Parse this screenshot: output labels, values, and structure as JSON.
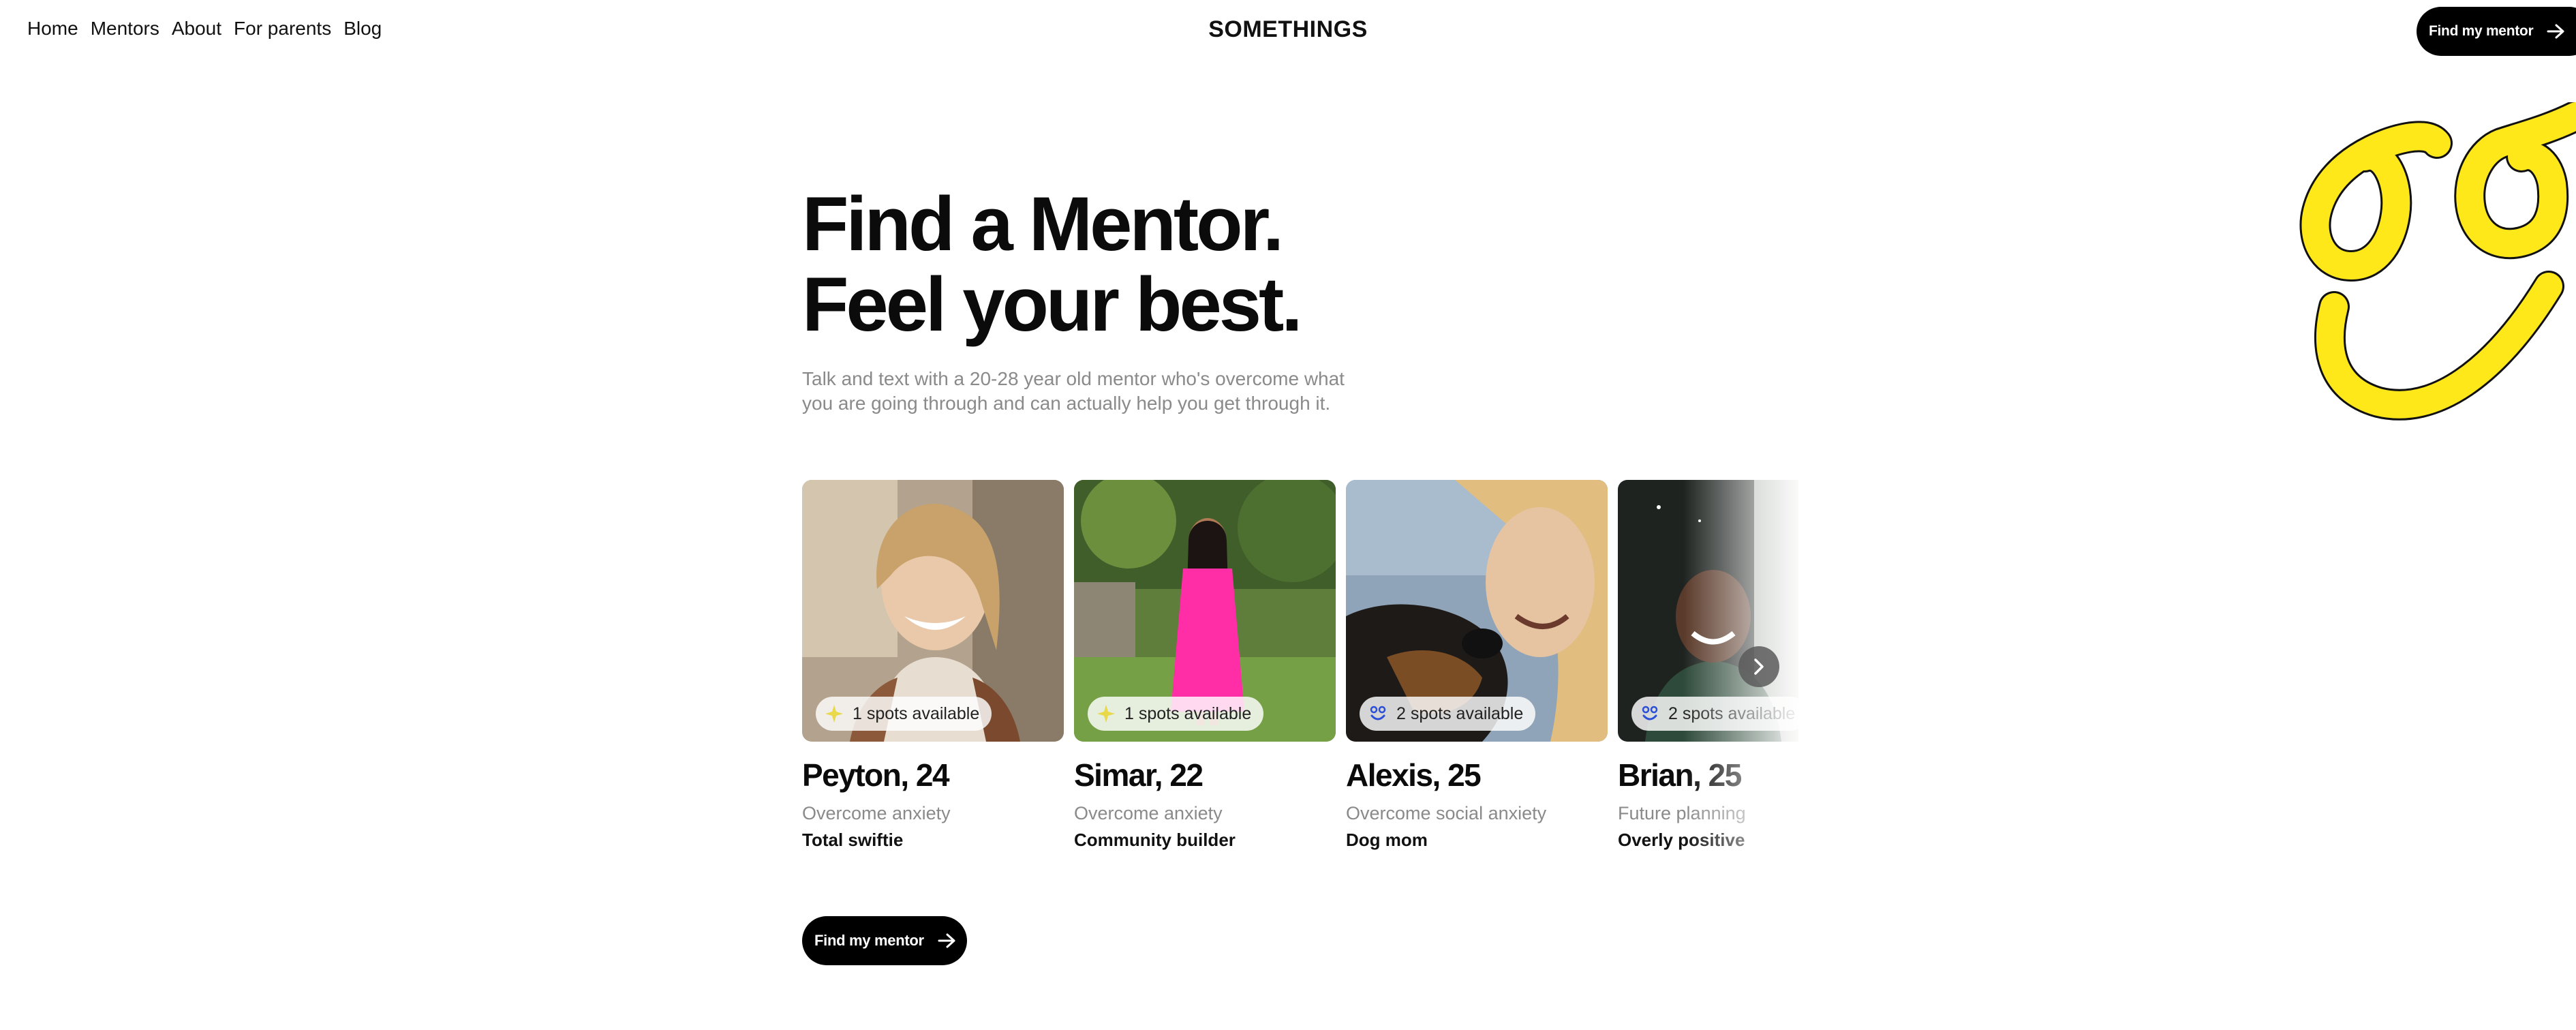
{
  "nav": {
    "items": [
      "Home",
      "Mentors",
      "About",
      "For parents",
      "Blog"
    ]
  },
  "brand": "SOMETHINGS",
  "header_cta": "Find my mentor",
  "hero": {
    "line1": "Find a Mentor.",
    "line2": "Feel your best.",
    "subtitle": "Talk and text with a 20-28 year old mentor who's overcome what you are going through and can actually help you get through it."
  },
  "mentors": [
    {
      "name": "Peyton, 24",
      "spots": "1 spots available",
      "tagline": "Overcome anxiety",
      "trait": "Total swiftie",
      "badge_icon": "sparkle-badge-icon"
    },
    {
      "name": "Simar, 22",
      "spots": "1 spots available",
      "tagline": "Overcome anxiety",
      "trait": "Community builder",
      "badge_icon": "sparkle-badge-icon"
    },
    {
      "name": "Alexis, 25",
      "spots": "2 spots available",
      "tagline": "Overcome social anxiety",
      "trait": "Dog mom",
      "badge_icon": "smile-badge-icon"
    },
    {
      "name": "Brian, 25",
      "spots": "2 spots available",
      "tagline": "Future planning",
      "trait": "Overly positive",
      "badge_icon": "smile-badge-icon"
    }
  ],
  "bottom_cta": "Find my mentor",
  "colors": {
    "accent_yellow": "#FFE81A",
    "button_black": "#000000",
    "muted_text": "#8A8A8A"
  }
}
